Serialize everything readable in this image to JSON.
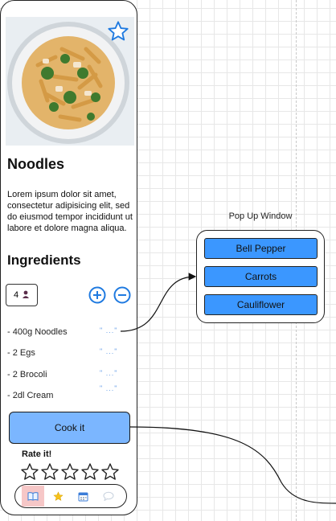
{
  "recipe": {
    "title": "Noodles",
    "description": "Lorem ipsum dolor sit amet, consectetur adipisicing elit, sed do eiusmod tempor incididunt ut labore et dolore magna aliqua.",
    "favorite_icon": "star-outline-icon"
  },
  "ingredients": {
    "heading": "Ingredients",
    "servings": "4",
    "items": [
      {
        "label": "- 400g Noodles",
        "marker": "\" ...\""
      },
      {
        "label": "- 2 Egs",
        "marker": "\" ...\""
      },
      {
        "label": "- 2 Brocoli",
        "marker": "\" ...\""
      },
      {
        "label": "- 2dl Cream",
        "marker": "\" ...\""
      }
    ]
  },
  "actions": {
    "cook_label": "Cook it",
    "rate_label": "Rate it!",
    "rating": 0,
    "rating_max": 5
  },
  "tabbar": {
    "tabs": [
      "book-icon",
      "star-icon",
      "calendar-icon",
      "chat-icon"
    ],
    "active": 0
  },
  "popup": {
    "title": "Pop Up Window",
    "options": [
      "Bell Pepper",
      "Carrots",
      "Cauliflower"
    ]
  },
  "colors": {
    "accent": "#1f7ae0",
    "cook_button": "#7bb6ff",
    "popup_button": "#3b97ff",
    "active_tab": "#f6c7c7"
  }
}
